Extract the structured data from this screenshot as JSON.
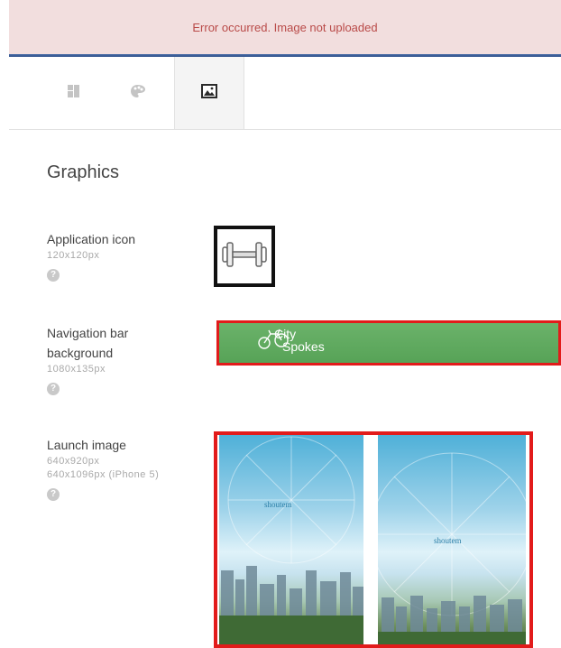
{
  "alert": {
    "message": "Error occurred. Image not uploaded"
  },
  "tabs": [
    {
      "icon": "layout-icon"
    },
    {
      "icon": "palette-icon"
    },
    {
      "icon": "image-icon",
      "active": true
    }
  ],
  "section": {
    "title": "Graphics"
  },
  "fields": {
    "app_icon": {
      "label": "Application icon",
      "size": "120x120px",
      "help": "?"
    },
    "nav_bar": {
      "label_line1": "Navigation bar",
      "label_line2": "background",
      "size": "1080x135px",
      "help": "?",
      "preview_text_1": "City",
      "preview_text_2": "Spokes"
    },
    "launch": {
      "label": "Launch image",
      "size1": "640x920px",
      "size2": "640x1096px (iPhone 5)",
      "help": "?",
      "brand_1": "shoutem",
      "brand_2": "shoutem"
    }
  },
  "colors": {
    "error_bg": "#f2dede",
    "error_text": "#b94a48",
    "highlight_border": "#e21b1b",
    "nav_green": "#5aa75a"
  }
}
